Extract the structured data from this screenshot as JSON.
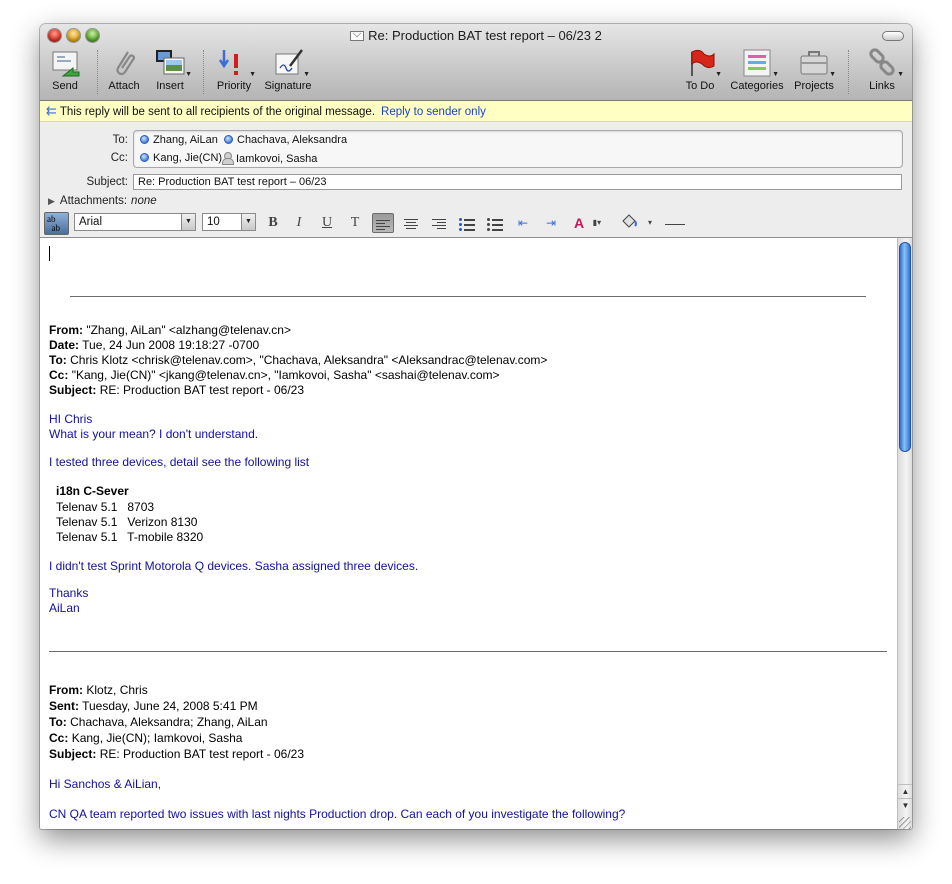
{
  "window": {
    "title": "Re: Production BAT test report – 06/23 2"
  },
  "toolbar": {
    "send": "Send",
    "attach": "Attach",
    "insert": "Insert",
    "priority": "Priority",
    "signature": "Signature",
    "todo": "To Do",
    "categories": "Categories",
    "projects": "Projects",
    "links": "Links"
  },
  "infobar": {
    "message": "This reply will be sent to all recipients of the original message.",
    "link": "Reply to sender only"
  },
  "header": {
    "to_label": "To:",
    "cc_label": "Cc:",
    "subject_label": "Subject:",
    "to": [
      "Zhang, AiLan",
      "Chachava, Aleksandra"
    ],
    "cc": [
      "Kang, Jie(CN)",
      "Iamkovoi, Sasha"
    ],
    "subject": "Re: Production BAT test report – 06/23",
    "attachments_label": "Attachments:",
    "attachments_value": "none"
  },
  "format": {
    "font": "Arial",
    "size": "10",
    "bold": "B",
    "italic": "I",
    "underline": "U",
    "text_style": "T",
    "font_color": "A"
  },
  "quote1": {
    "from_label": "From:",
    "from": "\"Zhang, AiLan\" <alzhang@telenav.cn>",
    "date_label": "Date:",
    "date": "Tue, 24 Jun 2008 19:18:27 -0700",
    "to_label": "To:",
    "to": "Chris Klotz <chrisk@telenav.com>, \"Chachava, Aleksandra\" <Aleksandrac@telenav.com>",
    "cc_label": "Cc:",
    "cc": "\"Kang, Jie(CN)\" <jkang@telenav.cn>, \"Iamkovoi, Sasha\" <sashai@telenav.com>",
    "subject_label": "Subject:",
    "subject": "RE: Production BAT test report - 06/23",
    "greeting": "HI Chris",
    "line1": "What is your mean? I don't understand.",
    "line2": "I tested three devices, detail see the following list",
    "list_title": "i18n C-Sever",
    "devices": [
      "Telenav 5.1   8703",
      "Telenav 5.1   Verizon 8130",
      "Telenav 5.1   T-mobile 8320"
    ],
    "line3": "I didn't test Sprint Motorola Q devices. Sasha assigned three devices.",
    "thanks": "Thanks",
    "sign": "AiLan"
  },
  "quote2": {
    "from_label": "From:",
    "from": "Klotz, Chris",
    "sent_label": "Sent:",
    "sent": "Tuesday, June 24, 2008 5:41 PM",
    "to_label": "To:",
    "to": "Chachava, Aleksandra; Zhang, AiLan",
    "cc_label": "Cc:",
    "cc": "Kang, Jie(CN); Iamkovoi, Sasha",
    "subject_label": "Subject:",
    "subject": "RE: Production BAT test report - 06/23",
    "greeting": "Hi Sanchos & AiLian,",
    "line1": "CN QA team reported two issues with last nights Production drop. Can each of you investigate the following?"
  },
  "colors": {
    "body_blue": "#13109e",
    "infobar_bg": "#ffffc4",
    "link_blue": "#1a43c8"
  }
}
